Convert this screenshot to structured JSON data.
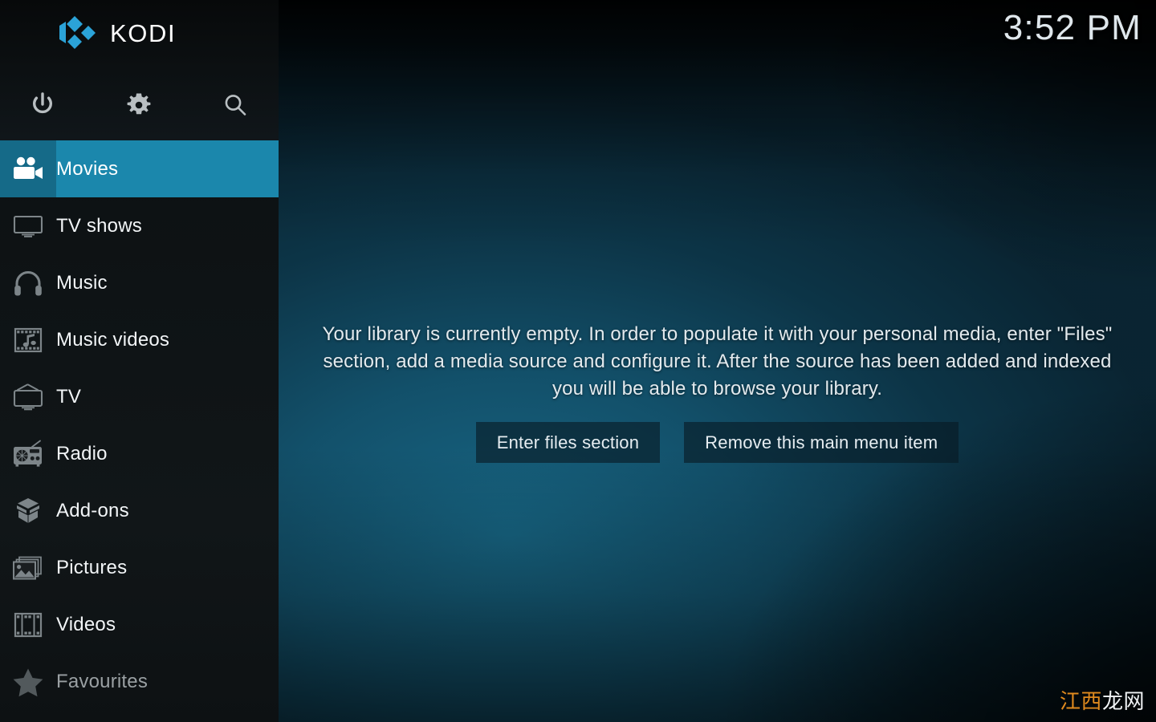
{
  "app": {
    "name": "KODI",
    "logo_color": "#2ba3d8"
  },
  "clock": {
    "time": "3:52 PM"
  },
  "toolbar": {
    "power_label": "Power",
    "settings_label": "Settings",
    "search_label": "Search",
    "icons": [
      "power-icon",
      "gear-icon",
      "search-icon"
    ]
  },
  "sidebar": {
    "accent_color": "#1b87ac",
    "accent_icon_color": "#156a88",
    "items": [
      {
        "label": "Movies",
        "icon": "movie-camera-icon",
        "active": true,
        "dim": false
      },
      {
        "label": "TV shows",
        "icon": "monitor-icon",
        "active": false,
        "dim": false
      },
      {
        "label": "Music",
        "icon": "headphones-icon",
        "active": false,
        "dim": false
      },
      {
        "label": "Music videos",
        "icon": "film-note-icon",
        "active": false,
        "dim": false
      },
      {
        "label": "TV",
        "icon": "retro-tv-icon",
        "active": false,
        "dim": false
      },
      {
        "label": "Radio",
        "icon": "radio-icon",
        "active": false,
        "dim": false
      },
      {
        "label": "Add-ons",
        "icon": "open-box-icon",
        "active": false,
        "dim": false
      },
      {
        "label": "Pictures",
        "icon": "photos-icon",
        "active": false,
        "dim": false
      },
      {
        "label": "Videos",
        "icon": "film-strip-icon",
        "active": false,
        "dim": false
      },
      {
        "label": "Favourites",
        "icon": "star-icon",
        "active": false,
        "dim": true
      }
    ]
  },
  "main": {
    "empty_message": "Your library is currently empty. In order to populate it with your personal media, enter \"Files\" section, add a media source and configure it. After the source has been added and indexed you will be able to browse your library.",
    "buttons": [
      {
        "label": "Enter files section"
      },
      {
        "label": "Remove this main menu item"
      }
    ]
  },
  "watermark": {
    "part1": "江西",
    "part2": "龙网",
    "color1": "#e08a1e",
    "color2": "#f0f2f4"
  }
}
